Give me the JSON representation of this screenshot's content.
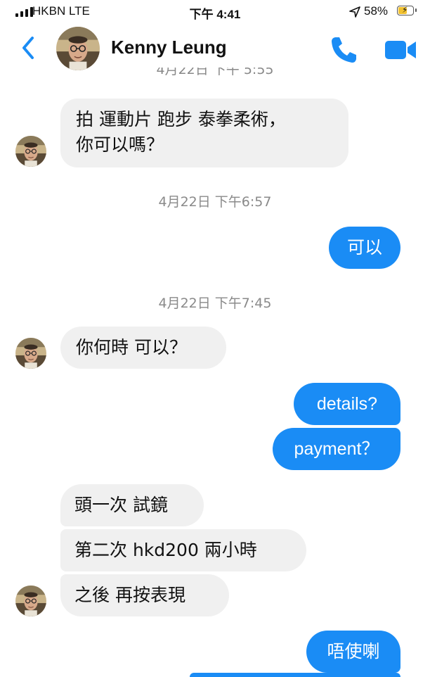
{
  "status_bar": {
    "carrier": "HKBN  LTE",
    "time": "下午 4:41",
    "battery": "58%"
  },
  "header": {
    "contact_name": "Kenny Leung",
    "icons": [
      "back-chevron-icon",
      "avatar",
      "phone-icon",
      "video-camera-icon"
    ]
  },
  "colors": {
    "accent": "#1a8cf5",
    "incoming_bubble": "#f0f0f0",
    "timestamp": "#8a8a8a"
  },
  "conversation": {
    "cut_timestamp": "4月22日 下午 5:55",
    "messages": [
      {
        "line1": "拍 運動片 跑步 泰拳柔術，",
        "line2": "你可以嗎？"
      },
      {
        "text": "可以"
      },
      {
        "text": "你何時 可以？"
      },
      {
        "text": "details?"
      },
      {
        "text": "payment？"
      },
      {
        "text": "頭一次 試鏡"
      },
      {
        "text": "第二次 hkd200 兩小時"
      },
      {
        "text": "之後 再按表現"
      },
      {
        "text": "唔使喇"
      }
    ],
    "timestamps": [
      "4月22日 下午6:57",
      "4月22日 下午7:45"
    ]
  }
}
